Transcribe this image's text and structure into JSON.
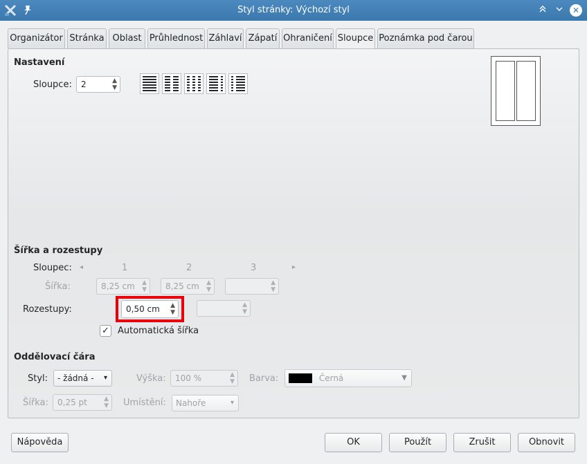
{
  "window": {
    "title": "Styl stránky: Výchozí styl",
    "close_glyph": "✕",
    "pin_glyph": "✎",
    "minimize_glyph": "︿",
    "maximize_glyph": "﹀"
  },
  "tabs": [
    {
      "label": "Organizátor",
      "active": false
    },
    {
      "label": "Stránka",
      "active": false
    },
    {
      "label": "Oblast",
      "active": false
    },
    {
      "label": "Průhlednost",
      "active": false
    },
    {
      "label": "Záhlaví",
      "active": false
    },
    {
      "label": "Zápatí",
      "active": false
    },
    {
      "label": "Ohraničení",
      "active": false
    },
    {
      "label": "Sloupce",
      "active": true
    },
    {
      "label": "Poznámka pod čarou",
      "active": false
    }
  ],
  "settings": {
    "heading": "Nastavení",
    "columns_label": "Sloupce:",
    "columns_value": "2"
  },
  "width_spacing": {
    "heading": "Šířka a rozestupy",
    "column_label": "Sloupec:",
    "column_numbers": [
      "1",
      "2",
      "3"
    ],
    "width_label": "Šířka:",
    "width_values": [
      "8,25 cm",
      "8,25 cm",
      ""
    ],
    "spacing_label": "Rozestupy:",
    "spacing_values": [
      "0,50 cm",
      ""
    ],
    "auto_width_label": "Automatická šířka",
    "auto_width_checked": true
  },
  "separator": {
    "heading": "Oddělovací čára",
    "style_label": "Styl:",
    "style_value": "- žádná -",
    "height_label": "Výška:",
    "height_value": "100 %",
    "color_label": "Barva:",
    "color_value": "Černá",
    "color_swatch": "#000000",
    "width_label": "Šířka:",
    "width_value": "0,25 pt",
    "position_label": "Umístění:",
    "position_value": "Nahoře"
  },
  "buttons": {
    "help": "Nápověda",
    "ok": "OK",
    "apply": "Použít",
    "cancel": "Zrušit",
    "reset": "Obnovit"
  },
  "colors": {
    "titlebar": "#3a78ad",
    "highlight": "#e8000b"
  }
}
